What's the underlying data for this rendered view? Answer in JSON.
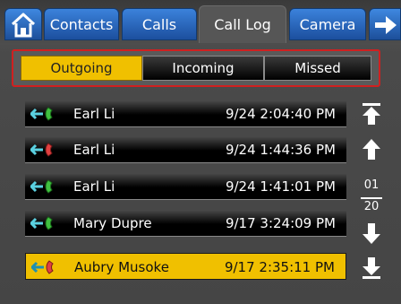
{
  "tabs": [
    {
      "label": "Contacts"
    },
    {
      "label": "Calls"
    },
    {
      "label": "Call Log"
    },
    {
      "label": "Camera"
    }
  ],
  "filter": {
    "outgoing": "Outgoing",
    "incoming": "Incoming",
    "missed": "Missed",
    "selected": "Outgoing"
  },
  "calls": [
    {
      "name": "Earl Li",
      "time": "9/24 2:04:40 PM",
      "icon": "outgoing-call-green-icon"
    },
    {
      "name": "Earl Li",
      "time": "9/24 1:44:36 PM",
      "icon": "outgoing-call-red-icon"
    },
    {
      "name": "Earl Li",
      "time": "9/24 1:41:01 PM",
      "icon": "outgoing-call-green-icon"
    },
    {
      "name": "Mary Dupre",
      "time": "9/17 3:24:09 PM",
      "icon": "outgoing-call-green-icon"
    },
    {
      "name": "Aubry Musoke",
      "time": "9/17 2:35:11 PM",
      "icon": "outgoing-call-red-icon"
    }
  ],
  "pager": {
    "current": "01",
    "total": "20"
  },
  "colors": {
    "selected": "#f0c000",
    "tab_blue": "#2a66c0",
    "highlight_border": "#d02020"
  }
}
